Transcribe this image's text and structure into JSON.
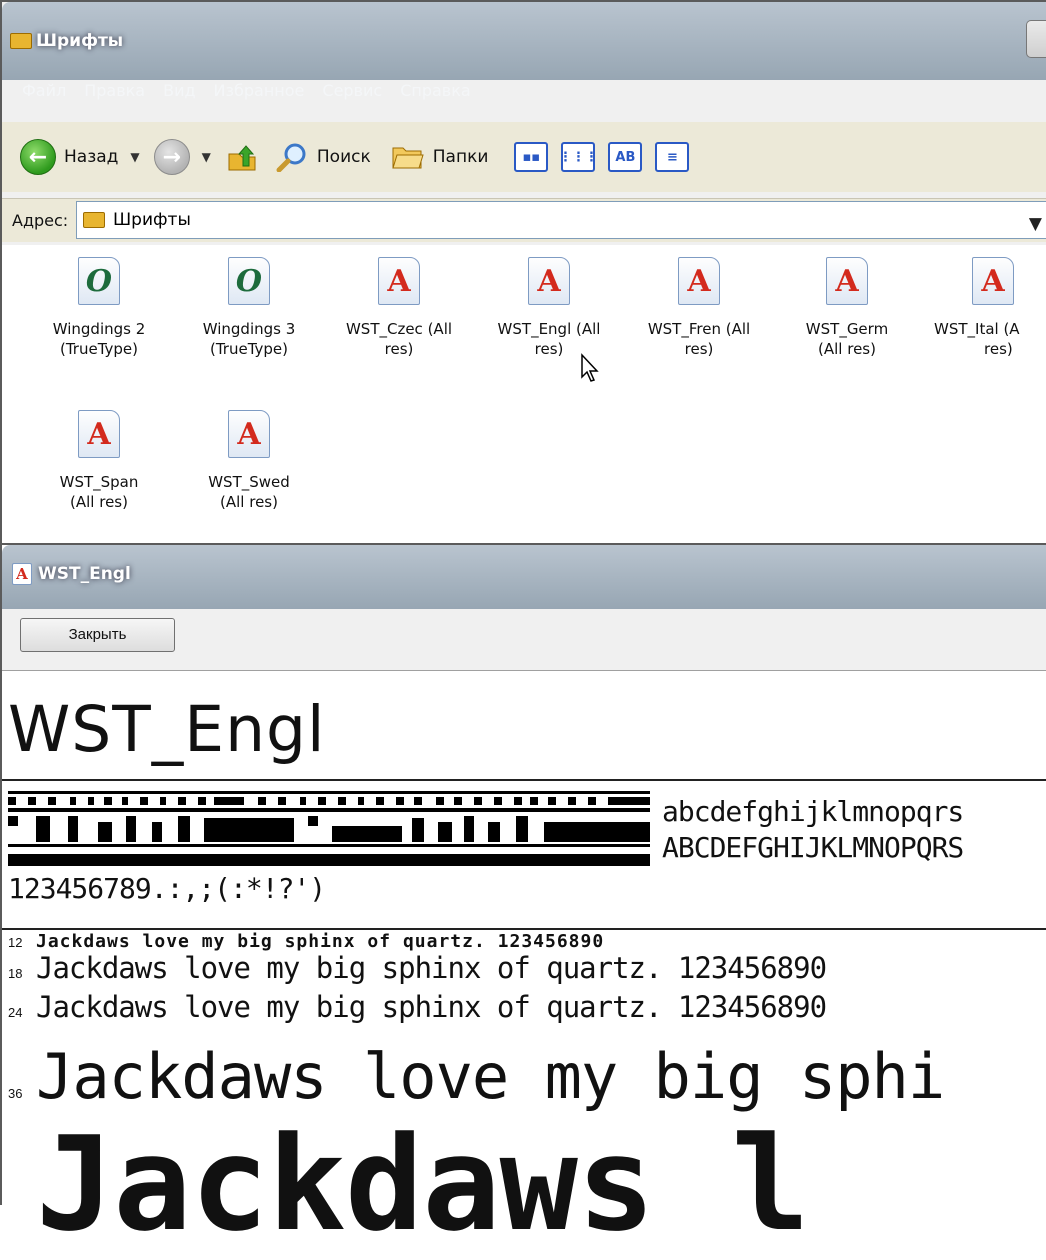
{
  "explorer": {
    "title": "Шрифты",
    "menu": [
      "Файл",
      "Правка",
      "Вид",
      "Избранное",
      "Сервис",
      "Справка"
    ],
    "toolbar": {
      "back_label": "Назад",
      "search_label": "Поиск",
      "folders_label": "Папки",
      "view_ab_label": "AB"
    },
    "address": {
      "label": "Адрес:",
      "value": "Шрифты"
    },
    "files": [
      {
        "line1": "Wingdings 2",
        "line2": "(TrueType)",
        "icon": "opentype-o-icon"
      },
      {
        "line1": "Wingdings 3",
        "line2": "(TrueType)",
        "icon": "opentype-o-icon"
      },
      {
        "line1": "WST_Czec (All",
        "line2": "res)",
        "icon": "font-a-icon"
      },
      {
        "line1": "WST_Engl (All",
        "line2": "res)",
        "icon": "font-a-icon"
      },
      {
        "line1": "WST_Fren (All",
        "line2": "res)",
        "icon": "font-a-icon"
      },
      {
        "line1": "WST_Germ",
        "line2": "(All res)",
        "icon": "font-a-icon"
      },
      {
        "line1": "WST_Ital (A",
        "line2": "res)",
        "icon": "font-a-icon"
      },
      {
        "line1": "WST_Span",
        "line2": "(All res)",
        "icon": "font-a-icon"
      },
      {
        "line1": "WST_Swed",
        "line2": "(All res)",
        "icon": "font-a-icon"
      }
    ]
  },
  "viewer": {
    "title": "WST_Engl",
    "close_label": "Закрыть",
    "font_name": "WST_Engl",
    "lowercase": "abcdefghijklmnopqrs",
    "uppercase": "ABCDEFGHIJKLMNOPQRS",
    "digits": "123456789.:,;(:*!?')",
    "samples": [
      {
        "size": "12",
        "text": "Jackdaws love my big sphinx of quartz. 123456890"
      },
      {
        "size": "18",
        "text": "Jackdaws love my big sphinx of quartz. 123456890"
      },
      {
        "size": "24",
        "text": "Jackdaws love my big sphinx of quartz. 123456890"
      },
      {
        "size": "36",
        "text": "Jackdaws love my big sphi"
      },
      {
        "size": "",
        "text": "Jackdaws l"
      }
    ]
  },
  "colors": {
    "titlebar": "#a8b5c1",
    "accent_blue": "#2a59c5",
    "font_a_red": "#d32a1d",
    "opentype_green": "#1d6b3c"
  }
}
